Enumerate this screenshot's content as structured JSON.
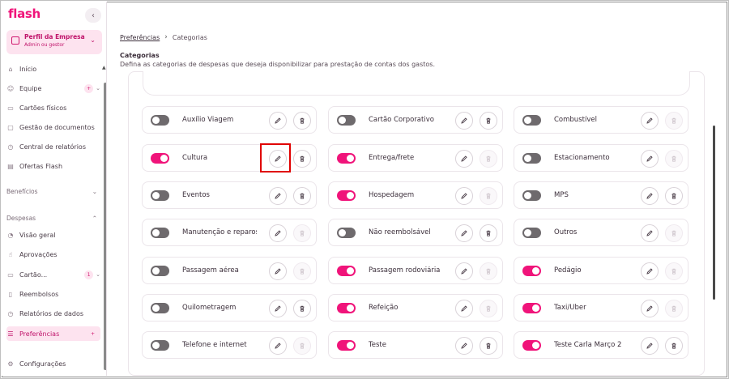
{
  "app": {
    "logo": "flash",
    "profile_title": "Perfil da Empresa",
    "profile_subtitle": "Admin ou gestor"
  },
  "sidebar": {
    "items": [
      {
        "label": "Início",
        "icon": "home-icon"
      },
      {
        "label": "Equipe",
        "icon": "people-icon",
        "badge": "+"
      },
      {
        "label": "Cartões físicos",
        "icon": "card-icon"
      },
      {
        "label": "Gestão de documentos",
        "icon": "folder-icon"
      },
      {
        "label": "Central de relatórios",
        "icon": "report-icon"
      },
      {
        "label": "Ofertas Flash",
        "icon": "offer-icon"
      }
    ],
    "section_beneficios": "Benefícios",
    "section_despesas": "Despesas",
    "despesas_items": [
      {
        "label": "Visão geral",
        "icon": "chart-icon"
      },
      {
        "label": "Aprovações",
        "icon": "thumb-icon"
      },
      {
        "label": "Cartão...",
        "icon": "card-icon",
        "badge": "1"
      },
      {
        "label": "Reembolsos",
        "icon": "receipt-icon"
      },
      {
        "label": "Relatórios de dados",
        "icon": "report-icon"
      },
      {
        "label": "Preferências",
        "icon": "settings-sliders-icon",
        "badge": "+"
      }
    ],
    "config_label": "Configurações"
  },
  "breadcrumb": {
    "parent": "Preferências",
    "current": "Categorias"
  },
  "page": {
    "title": "Categorias",
    "description": "Defina as categorias de despesas que deseja disponibilizar para prestação de contas dos gastos."
  },
  "categories": [
    {
      "label": "Auxílio Viagem",
      "on": false,
      "delete_enabled": true
    },
    {
      "label": "Cartão Corporativo",
      "on": false,
      "delete_enabled": true
    },
    {
      "label": "Combustível",
      "on": false,
      "delete_enabled": false
    },
    {
      "label": "Cultura",
      "on": true,
      "delete_enabled": true
    },
    {
      "label": "Entrega/frete",
      "on": true,
      "delete_enabled": false
    },
    {
      "label": "Estacionamento",
      "on": false,
      "delete_enabled": false
    },
    {
      "label": "Eventos",
      "on": false,
      "delete_enabled": true
    },
    {
      "label": "Hospedagem",
      "on": true,
      "delete_enabled": false
    },
    {
      "label": "MPS",
      "on": false,
      "delete_enabled": true
    },
    {
      "label": "Manutenção e reparos",
      "on": false,
      "delete_enabled": false
    },
    {
      "label": "Não reembolsável",
      "on": false,
      "delete_enabled": true
    },
    {
      "label": "Outros",
      "on": false,
      "delete_enabled": false
    },
    {
      "label": "Passagem aérea",
      "on": false,
      "delete_enabled": false
    },
    {
      "label": "Passagem rodoviária",
      "on": true,
      "delete_enabled": false
    },
    {
      "label": "Pedágio",
      "on": true,
      "delete_enabled": false
    },
    {
      "label": "Quilometragem",
      "on": false,
      "delete_enabled": true
    },
    {
      "label": "Refeição",
      "on": true,
      "delete_enabled": false
    },
    {
      "label": "Taxi/Uber",
      "on": true,
      "delete_enabled": false
    },
    {
      "label": "Telefone e internet",
      "on": false,
      "delete_enabled": false
    },
    {
      "label": "Teste",
      "on": true,
      "delete_enabled": true
    },
    {
      "label": "Teste Carla Março 2",
      "on": true,
      "delete_enabled": true
    }
  ],
  "colors": {
    "brand": "#f0147a",
    "toggle_off": "#6e6a6d",
    "highlight": "#e00000"
  }
}
